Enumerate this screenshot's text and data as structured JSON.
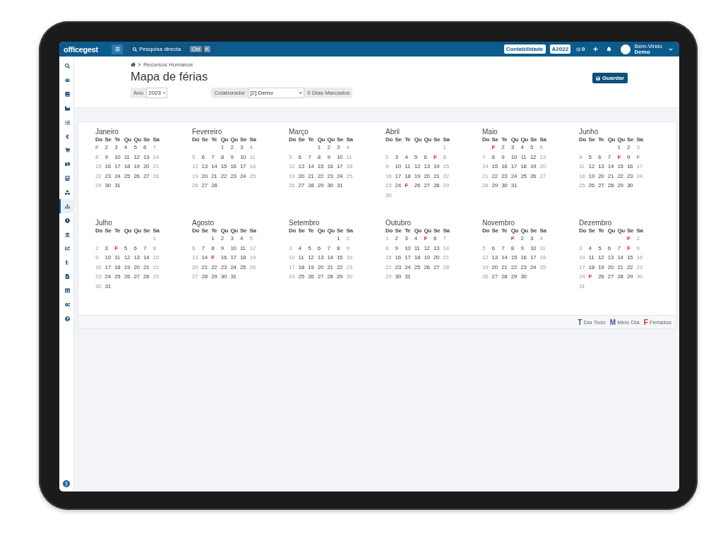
{
  "topbar": {
    "logo": "officegest",
    "search": {
      "placeholder": "Pesquisa directa",
      "keys": [
        "Ctrl",
        "K"
      ]
    },
    "buttons": [
      "Contabilidade",
      "A2022"
    ],
    "tasks_count": "0",
    "greeting": "Bem-Vindo",
    "user": "Demo"
  },
  "sidebar": {
    "items": [
      {
        "selected": false
      },
      {
        "selected": false
      },
      {
        "selected": false
      },
      {
        "selected": false
      },
      {
        "selected": false
      },
      {
        "selected": false
      },
      {
        "selected": false
      },
      {
        "selected": false
      },
      {
        "selected": false
      },
      {
        "selected": false
      },
      {
        "selected": true
      },
      {
        "selected": false
      },
      {
        "selected": false
      },
      {
        "selected": false
      },
      {
        "selected": false
      },
      {
        "selected": false
      },
      {
        "selected": false
      },
      {
        "selected": false
      },
      {
        "selected": false
      }
    ]
  },
  "breadcrumb": [
    "Recursos Humanos"
  ],
  "title": "Mapa de férias",
  "save_button": "Guardar",
  "filters": {
    "year_label": "Ano",
    "year": "2023",
    "employee_label": "Colaborador",
    "employee": "[2] Demo",
    "marked_days": "0 Dias Marcados"
  },
  "months": [
    {
      "name": "Janeiro",
      "weekdays": [
        "Do",
        "Se",
        "Te",
        "Qu",
        "Qu",
        "Se",
        "Sa"
      ],
      "weeks": [
        [
          {
            "day": "F",
            "holiday": true
          },
          {
            "day": "2",
            "holiday": false
          },
          {
            "day": "3",
            "holiday": false
          },
          {
            "day": "4",
            "holiday": false
          },
          {
            "day": "5",
            "holiday": false
          },
          {
            "day": "6",
            "holiday": false
          },
          {
            "day": "7",
            "holiday": false
          }
        ],
        [
          {
            "day": "8",
            "holiday": false
          },
          {
            "day": "9",
            "holiday": false
          },
          {
            "day": "10",
            "holiday": false
          },
          {
            "day": "11",
            "holiday": false
          },
          {
            "day": "12",
            "holiday": false
          },
          {
            "day": "13",
            "holiday": false
          },
          {
            "day": "14",
            "holiday": false
          }
        ],
        [
          {
            "day": "15",
            "holiday": false
          },
          {
            "day": "16",
            "holiday": false
          },
          {
            "day": "17",
            "holiday": false
          },
          {
            "day": "18",
            "holiday": false
          },
          {
            "day": "19",
            "holiday": false
          },
          {
            "day": "20",
            "holiday": false
          },
          {
            "day": "21",
            "holiday": false
          }
        ],
        [
          {
            "day": "22",
            "holiday": false
          },
          {
            "day": "23",
            "holiday": false
          },
          {
            "day": "24",
            "holiday": false
          },
          {
            "day": "25",
            "holiday": false
          },
          {
            "day": "26",
            "holiday": false
          },
          {
            "day": "27",
            "holiday": false
          },
          {
            "day": "28",
            "holiday": false
          }
        ],
        [
          {
            "day": "29",
            "holiday": false
          },
          {
            "day": "30",
            "holiday": false
          },
          {
            "day": "31",
            "holiday": false
          }
        ]
      ]
    },
    {
      "name": "Fevereiro",
      "weekdays": [
        "Do",
        "Se",
        "Te",
        "Qu",
        "Qu",
        "Se",
        "Sa"
      ],
      "weeks": [
        [
          {
            "day": "1",
            "holiday": false
          },
          {
            "day": "2",
            "holiday": false
          },
          {
            "day": "3",
            "holiday": false
          },
          {
            "day": "4",
            "holiday": false
          }
        ],
        [
          {
            "day": "5",
            "holiday": false
          },
          {
            "day": "6",
            "holiday": false
          },
          {
            "day": "7",
            "holiday": false
          },
          {
            "day": "8",
            "holiday": false
          },
          {
            "day": "9",
            "holiday": false
          },
          {
            "day": "10",
            "holiday": false
          },
          {
            "day": "11",
            "holiday": false
          }
        ],
        [
          {
            "day": "12",
            "holiday": false
          },
          {
            "day": "13",
            "holiday": false
          },
          {
            "day": "14",
            "holiday": false
          },
          {
            "day": "15",
            "holiday": false
          },
          {
            "day": "16",
            "holiday": false
          },
          {
            "day": "17",
            "holiday": false
          },
          {
            "day": "18",
            "holiday": false
          }
        ],
        [
          {
            "day": "19",
            "holiday": false
          },
          {
            "day": "20",
            "holiday": false
          },
          {
            "day": "21",
            "holiday": false
          },
          {
            "day": "22",
            "holiday": false
          },
          {
            "day": "23",
            "holiday": false
          },
          {
            "day": "24",
            "holiday": false
          },
          {
            "day": "25",
            "holiday": false
          }
        ],
        [
          {
            "day": "26",
            "holiday": false
          },
          {
            "day": "27",
            "holiday": false
          },
          {
            "day": "28",
            "holiday": false
          }
        ]
      ]
    },
    {
      "name": "Março",
      "weekdays": [
        "Do",
        "Se",
        "Te",
        "Qu",
        "Qu",
        "Se",
        "Sa"
      ],
      "weeks": [
        [
          {
            "day": "1",
            "holiday": false
          },
          {
            "day": "2",
            "holiday": false
          },
          {
            "day": "3",
            "holiday": false
          },
          {
            "day": "4",
            "holiday": false
          }
        ],
        [
          {
            "day": "5",
            "holiday": false
          },
          {
            "day": "6",
            "holiday": false
          },
          {
            "day": "7",
            "holiday": false
          },
          {
            "day": "8",
            "holiday": false
          },
          {
            "day": "9",
            "holiday": false
          },
          {
            "day": "10",
            "holiday": false
          },
          {
            "day": "11",
            "holiday": false
          }
        ],
        [
          {
            "day": "12",
            "holiday": false
          },
          {
            "day": "13",
            "holiday": false
          },
          {
            "day": "14",
            "holiday": false
          },
          {
            "day": "15",
            "holiday": false
          },
          {
            "day": "16",
            "holiday": false
          },
          {
            "day": "17",
            "holiday": false
          },
          {
            "day": "18",
            "holiday": false
          }
        ],
        [
          {
            "day": "19",
            "holiday": false
          },
          {
            "day": "20",
            "holiday": false
          },
          {
            "day": "21",
            "holiday": false
          },
          {
            "day": "22",
            "holiday": false
          },
          {
            "day": "23",
            "holiday": false
          },
          {
            "day": "24",
            "holiday": false
          },
          {
            "day": "25",
            "holiday": false
          }
        ],
        [
          {
            "day": "26",
            "holiday": false
          },
          {
            "day": "27",
            "holiday": false
          },
          {
            "day": "28",
            "holiday": false
          },
          {
            "day": "29",
            "holiday": false
          },
          {
            "day": "30",
            "holiday": false
          },
          {
            "day": "31",
            "holiday": false
          }
        ]
      ]
    },
    {
      "name": "Abril",
      "weekdays": [
        "Do",
        "Se",
        "Te",
        "Qu",
        "Qu",
        "Se",
        "Sa"
      ],
      "weeks": [
        [
          {
            "day": "1",
            "holiday": false
          }
        ],
        [
          {
            "day": "2",
            "holiday": false
          },
          {
            "day": "3",
            "holiday": false
          },
          {
            "day": "4",
            "holiday": false
          },
          {
            "day": "5",
            "holiday": false
          },
          {
            "day": "6",
            "holiday": false
          },
          {
            "day": "F",
            "holiday": true
          },
          {
            "day": "8",
            "holiday": false
          }
        ],
        [
          {
            "day": "9",
            "holiday": false
          },
          {
            "day": "10",
            "holiday": false
          },
          {
            "day": "11",
            "holiday": false
          },
          {
            "day": "12",
            "holiday": false
          },
          {
            "day": "13",
            "holiday": false
          },
          {
            "day": "14",
            "holiday": false
          },
          {
            "day": "15",
            "holiday": false
          }
        ],
        [
          {
            "day": "16",
            "holiday": false
          },
          {
            "day": "17",
            "holiday": false
          },
          {
            "day": "18",
            "holiday": false
          },
          {
            "day": "19",
            "holiday": false
          },
          {
            "day": "20",
            "holiday": false
          },
          {
            "day": "21",
            "holiday": false
          },
          {
            "day": "22",
            "holiday": false
          }
        ],
        [
          {
            "day": "23",
            "holiday": false
          },
          {
            "day": "24",
            "holiday": false
          },
          {
            "day": "F",
            "holiday": true
          },
          {
            "day": "26",
            "holiday": false
          },
          {
            "day": "27",
            "holiday": false
          },
          {
            "day": "28",
            "holiday": false
          },
          {
            "day": "29",
            "holiday": false
          }
        ],
        [
          {
            "day": "30",
            "holiday": false
          }
        ]
      ]
    },
    {
      "name": "Maio",
      "weekdays": [
        "Do",
        "Se",
        "Te",
        "Qu",
        "Qu",
        "Se",
        "Sa"
      ],
      "weeks": [
        [
          {
            "day": "F",
            "holiday": true
          },
          {
            "day": "2",
            "holiday": false
          },
          {
            "day": "3",
            "holiday": false
          },
          {
            "day": "4",
            "holiday": false
          },
          {
            "day": "5",
            "holiday": false
          },
          {
            "day": "6",
            "holiday": false
          }
        ],
        [
          {
            "day": "7",
            "holiday": false
          },
          {
            "day": "8",
            "holiday": false
          },
          {
            "day": "9",
            "holiday": false
          },
          {
            "day": "10",
            "holiday": false
          },
          {
            "day": "11",
            "holiday": false
          },
          {
            "day": "12",
            "holiday": false
          },
          {
            "day": "13",
            "holiday": false
          }
        ],
        [
          {
            "day": "14",
            "holiday": false
          },
          {
            "day": "15",
            "holiday": false
          },
          {
            "day": "16",
            "holiday": false
          },
          {
            "day": "17",
            "holiday": false
          },
          {
            "day": "18",
            "holiday": false
          },
          {
            "day": "19",
            "holiday": false
          },
          {
            "day": "20",
            "holiday": false
          }
        ],
        [
          {
            "day": "21",
            "holiday": false
          },
          {
            "day": "22",
            "holiday": false
          },
          {
            "day": "23",
            "holiday": false
          },
          {
            "day": "24",
            "holiday": false
          },
          {
            "day": "25",
            "holiday": false
          },
          {
            "day": "26",
            "holiday": false
          },
          {
            "day": "27",
            "holiday": false
          }
        ],
        [
          {
            "day": "28",
            "holiday": false
          },
          {
            "day": "29",
            "holiday": false
          },
          {
            "day": "30",
            "holiday": false
          },
          {
            "day": "31",
            "holiday": false
          }
        ]
      ]
    },
    {
      "name": "Junho",
      "weekdays": [
        "Do",
        "Se",
        "Te",
        "Qu",
        "Qu",
        "Se",
        "Sa"
      ],
      "weeks": [
        [
          {
            "day": "1",
            "holiday": false
          },
          {
            "day": "2",
            "holiday": false
          },
          {
            "day": "3",
            "holiday": false
          }
        ],
        [
          {
            "day": "4",
            "holiday": false
          },
          {
            "day": "5",
            "holiday": false
          },
          {
            "day": "6",
            "holiday": false
          },
          {
            "day": "7",
            "holiday": false
          },
          {
            "day": "F",
            "holiday": true
          },
          {
            "day": "9",
            "holiday": false
          },
          {
            "day": "F",
            "holiday": true
          }
        ],
        [
          {
            "day": "11",
            "holiday": false
          },
          {
            "day": "12",
            "holiday": false
          },
          {
            "day": "13",
            "holiday": false
          },
          {
            "day": "14",
            "holiday": false
          },
          {
            "day": "15",
            "holiday": false
          },
          {
            "day": "16",
            "holiday": false
          },
          {
            "day": "17",
            "holiday": false
          }
        ],
        [
          {
            "day": "18",
            "holiday": false
          },
          {
            "day": "19",
            "holiday": false
          },
          {
            "day": "20",
            "holiday": false
          },
          {
            "day": "21",
            "holiday": false
          },
          {
            "day": "22",
            "holiday": false
          },
          {
            "day": "23",
            "holiday": false
          },
          {
            "day": "24",
            "holiday": false
          }
        ],
        [
          {
            "day": "25",
            "holiday": false
          },
          {
            "day": "26",
            "holiday": false
          },
          {
            "day": "27",
            "holiday": false
          },
          {
            "day": "28",
            "holiday": false
          },
          {
            "day": "29",
            "holiday": false
          },
          {
            "day": "30",
            "holiday": false
          }
        ]
      ]
    },
    {
      "name": "Julho",
      "weekdays": [
        "Do",
        "Se",
        "Te",
        "Qu",
        "Qu",
        "Se",
        "Sa"
      ],
      "weeks": [
        [
          {
            "day": "1",
            "holiday": false
          }
        ],
        [
          {
            "day": "2",
            "holiday": false
          },
          {
            "day": "3",
            "holiday": false
          },
          {
            "day": "F",
            "holiday": true
          },
          {
            "day": "5",
            "holiday": false
          },
          {
            "day": "6",
            "holiday": false
          },
          {
            "day": "7",
            "holiday": false
          },
          {
            "day": "8",
            "holiday": false
          }
        ],
        [
          {
            "day": "9",
            "holiday": false
          },
          {
            "day": "10",
            "holiday": false
          },
          {
            "day": "11",
            "holiday": false
          },
          {
            "day": "12",
            "holiday": false
          },
          {
            "day": "13",
            "holiday": false
          },
          {
            "day": "14",
            "holiday": false
          },
          {
            "day": "15",
            "holiday": false
          }
        ],
        [
          {
            "day": "16",
            "holiday": false
          },
          {
            "day": "17",
            "holiday": false
          },
          {
            "day": "18",
            "holiday": false
          },
          {
            "day": "19",
            "holiday": false
          },
          {
            "day": "20",
            "holiday": false
          },
          {
            "day": "21",
            "holiday": false
          },
          {
            "day": "22",
            "holiday": false
          }
        ],
        [
          {
            "day": "23",
            "holiday": false
          },
          {
            "day": "24",
            "holiday": false
          },
          {
            "day": "25",
            "holiday": false
          },
          {
            "day": "26",
            "holiday": false
          },
          {
            "day": "27",
            "holiday": false
          },
          {
            "day": "28",
            "holiday": false
          },
          {
            "day": "29",
            "holiday": false
          }
        ],
        [
          {
            "day": "30",
            "holiday": false
          },
          {
            "day": "31",
            "holiday": false
          }
        ]
      ]
    },
    {
      "name": "Agosto",
      "weekdays": [
        "Do",
        "Se",
        "Te",
        "Qu",
        "Qu",
        "Se",
        "Sa"
      ],
      "weeks": [
        [
          {
            "day": "1",
            "holiday": false
          },
          {
            "day": "2",
            "holiday": false
          },
          {
            "day": "3",
            "holiday": false
          },
          {
            "day": "4",
            "holiday": false
          },
          {
            "day": "5",
            "holiday": false
          }
        ],
        [
          {
            "day": "6",
            "holiday": false
          },
          {
            "day": "7",
            "holiday": false
          },
          {
            "day": "8",
            "holiday": false
          },
          {
            "day": "9",
            "holiday": false
          },
          {
            "day": "10",
            "holiday": false
          },
          {
            "day": "11",
            "holiday": false
          },
          {
            "day": "12",
            "holiday": false
          }
        ],
        [
          {
            "day": "13",
            "holiday": false
          },
          {
            "day": "14",
            "holiday": false
          },
          {
            "day": "F",
            "holiday": true
          },
          {
            "day": "16",
            "holiday": false
          },
          {
            "day": "17",
            "holiday": false
          },
          {
            "day": "18",
            "holiday": false
          },
          {
            "day": "19",
            "holiday": false
          }
        ],
        [
          {
            "day": "20",
            "holiday": false
          },
          {
            "day": "21",
            "holiday": false
          },
          {
            "day": "22",
            "holiday": false
          },
          {
            "day": "23",
            "holiday": false
          },
          {
            "day": "24",
            "holiday": false
          },
          {
            "day": "25",
            "holiday": false
          },
          {
            "day": "26",
            "holiday": false
          }
        ],
        [
          {
            "day": "27",
            "holiday": false
          },
          {
            "day": "28",
            "holiday": false
          },
          {
            "day": "29",
            "holiday": false
          },
          {
            "day": "30",
            "holiday": false
          },
          {
            "day": "31",
            "holiday": false
          }
        ]
      ]
    },
    {
      "name": "Setembro",
      "weekdays": [
        "Do",
        "Se",
        "Te",
        "Qu",
        "Qu",
        "Se",
        "Sa"
      ],
      "weeks": [
        [
          {
            "day": "1",
            "holiday": false
          },
          {
            "day": "2",
            "holiday": false
          }
        ],
        [
          {
            "day": "3",
            "holiday": false
          },
          {
            "day": "4",
            "holiday": false
          },
          {
            "day": "5",
            "holiday": false
          },
          {
            "day": "6",
            "holiday": false
          },
          {
            "day": "7",
            "holiday": false
          },
          {
            "day": "8",
            "holiday": false
          },
          {
            "day": "9",
            "holiday": false
          }
        ],
        [
          {
            "day": "10",
            "holiday": false
          },
          {
            "day": "11",
            "holiday": false
          },
          {
            "day": "12",
            "holiday": false
          },
          {
            "day": "13",
            "holiday": false
          },
          {
            "day": "14",
            "holiday": false
          },
          {
            "day": "15",
            "holiday": false
          },
          {
            "day": "16",
            "holiday": false
          }
        ],
        [
          {
            "day": "17",
            "holiday": false
          },
          {
            "day": "18",
            "holiday": false
          },
          {
            "day": "19",
            "holiday": false
          },
          {
            "day": "20",
            "holiday": false
          },
          {
            "day": "21",
            "holiday": false
          },
          {
            "day": "22",
            "holiday": false
          },
          {
            "day": "23",
            "holiday": false
          }
        ],
        [
          {
            "day": "24",
            "holiday": false
          },
          {
            "day": "25",
            "holiday": false
          },
          {
            "day": "26",
            "holiday": false
          },
          {
            "day": "27",
            "holiday": false
          },
          {
            "day": "28",
            "holiday": false
          },
          {
            "day": "29",
            "holiday": false
          },
          {
            "day": "30",
            "holiday": false
          }
        ]
      ]
    },
    {
      "name": "Outubro",
      "weekdays": [
        "Do",
        "Se",
        "Te",
        "Qu",
        "Qu",
        "Se",
        "Sa"
      ],
      "weeks": [
        [
          {
            "day": "1",
            "holiday": false
          },
          {
            "day": "2",
            "holiday": false
          },
          {
            "day": "3",
            "holiday": false
          },
          {
            "day": "4",
            "holiday": false
          },
          {
            "day": "F",
            "holiday": true
          },
          {
            "day": "6",
            "holiday": false
          },
          {
            "day": "7",
            "holiday": false
          }
        ],
        [
          {
            "day": "8",
            "holiday": false
          },
          {
            "day": "9",
            "holiday": false
          },
          {
            "day": "10",
            "holiday": false
          },
          {
            "day": "11",
            "holiday": false
          },
          {
            "day": "12",
            "holiday": false
          },
          {
            "day": "13",
            "holiday": false
          },
          {
            "day": "14",
            "holiday": false
          }
        ],
        [
          {
            "day": "15",
            "holiday": false
          },
          {
            "day": "16",
            "holiday": false
          },
          {
            "day": "17",
            "holiday": false
          },
          {
            "day": "18",
            "holiday": false
          },
          {
            "day": "19",
            "holiday": false
          },
          {
            "day": "20",
            "holiday": false
          },
          {
            "day": "21",
            "holiday": false
          }
        ],
        [
          {
            "day": "22",
            "holiday": false
          },
          {
            "day": "23",
            "holiday": false
          },
          {
            "day": "24",
            "holiday": false
          },
          {
            "day": "25",
            "holiday": false
          },
          {
            "day": "26",
            "holiday": false
          },
          {
            "day": "27",
            "holiday": false
          },
          {
            "day": "28",
            "holiday": false
          }
        ],
        [
          {
            "day": "29",
            "holiday": false
          },
          {
            "day": "30",
            "holiday": false
          },
          {
            "day": "31",
            "holiday": false
          }
        ]
      ]
    },
    {
      "name": "Novembro",
      "weekdays": [
        "Do",
        "Se",
        "Te",
        "Qu",
        "Qu",
        "Se",
        "Sa"
      ],
      "weeks": [
        [
          {
            "day": "F",
            "holiday": true
          },
          {
            "day": "2",
            "holiday": false
          },
          {
            "day": "3",
            "holiday": false
          },
          {
            "day": "4",
            "holiday": false
          }
        ],
        [
          {
            "day": "5",
            "holiday": false
          },
          {
            "day": "6",
            "holiday": false
          },
          {
            "day": "7",
            "holiday": false
          },
          {
            "day": "8",
            "holiday": false
          },
          {
            "day": "9",
            "holiday": false
          },
          {
            "day": "10",
            "holiday": false
          },
          {
            "day": "11",
            "holiday": false
          }
        ],
        [
          {
            "day": "12",
            "holiday": false
          },
          {
            "day": "13",
            "holiday": false
          },
          {
            "day": "14",
            "holiday": false
          },
          {
            "day": "15",
            "holiday": false
          },
          {
            "day": "16",
            "holiday": false
          },
          {
            "day": "17",
            "holiday": false
          },
          {
            "day": "18",
            "holiday": false
          }
        ],
        [
          {
            "day": "19",
            "holiday": false
          },
          {
            "day": "20",
            "holiday": false
          },
          {
            "day": "21",
            "holiday": false
          },
          {
            "day": "22",
            "holiday": false
          },
          {
            "day": "23",
            "holiday": false
          },
          {
            "day": "24",
            "holiday": false
          },
          {
            "day": "25",
            "holiday": false
          }
        ],
        [
          {
            "day": "26",
            "holiday": false
          },
          {
            "day": "27",
            "holiday": false
          },
          {
            "day": "28",
            "holiday": false
          },
          {
            "day": "29",
            "holiday": false
          },
          {
            "day": "30",
            "holiday": false
          }
        ]
      ]
    },
    {
      "name": "Dezembro",
      "weekdays": [
        "Do",
        "Se",
        "Te",
        "Qu",
        "Qu",
        "Se",
        "Sa"
      ],
      "weeks": [
        [
          {
            "day": "F",
            "holiday": true
          },
          {
            "day": "2",
            "holiday": false
          }
        ],
        [
          {
            "day": "3",
            "holiday": false
          },
          {
            "day": "4",
            "holiday": false
          },
          {
            "day": "5",
            "holiday": false
          },
          {
            "day": "6",
            "holiday": false
          },
          {
            "day": "7",
            "holiday": false
          },
          {
            "day": "F",
            "holiday": true
          },
          {
            "day": "9",
            "holiday": false
          }
        ],
        [
          {
            "day": "10",
            "holiday": false
          },
          {
            "day": "11",
            "holiday": false
          },
          {
            "day": "12",
            "holiday": false
          },
          {
            "day": "13",
            "holiday": false
          },
          {
            "day": "14",
            "holiday": false
          },
          {
            "day": "15",
            "holiday": false
          },
          {
            "day": "16",
            "holiday": false
          }
        ],
        [
          {
            "day": "17",
            "holiday": false
          },
          {
            "day": "18",
            "holiday": false
          },
          {
            "day": "19",
            "holiday": false
          },
          {
            "day": "20",
            "holiday": false
          },
          {
            "day": "21",
            "holiday": false
          },
          {
            "day": "22",
            "holiday": false
          },
          {
            "day": "23",
            "holiday": false
          }
        ],
        [
          {
            "day": "24",
            "holiday": false
          },
          {
            "day": "F",
            "holiday": true
          },
          {
            "day": "26",
            "holiday": false
          },
          {
            "day": "27",
            "holiday": false
          },
          {
            "day": "28",
            "holiday": false
          },
          {
            "day": "29",
            "holiday": false
          },
          {
            "day": "30",
            "holiday": false
          }
        ],
        [
          {
            "day": "31",
            "holiday": false
          }
        ]
      ]
    }
  ],
  "legend": [
    {
      "letter": "T",
      "label": "Dia Todo",
      "color": "#1f5a8c"
    },
    {
      "letter": "M",
      "label": "Meio Dia",
      "color": "#3a4fb0"
    },
    {
      "letter": "F",
      "label": "Feriados",
      "color": "#e0242f"
    }
  ]
}
